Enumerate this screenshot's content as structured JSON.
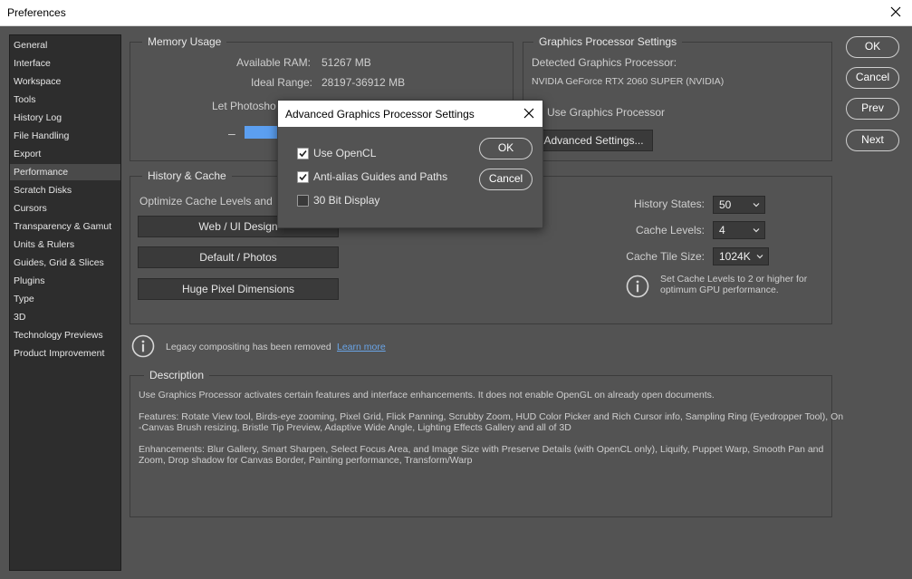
{
  "window": {
    "title": "Preferences"
  },
  "sidebar": {
    "items": [
      {
        "label": "General"
      },
      {
        "label": "Interface"
      },
      {
        "label": "Workspace"
      },
      {
        "label": "Tools"
      },
      {
        "label": "History Log"
      },
      {
        "label": "File Handling"
      },
      {
        "label": "Export"
      },
      {
        "label": "Performance"
      },
      {
        "label": "Scratch Disks"
      },
      {
        "label": "Cursors"
      },
      {
        "label": "Transparency & Gamut"
      },
      {
        "label": "Units & Rulers"
      },
      {
        "label": "Guides, Grid & Slices"
      },
      {
        "label": "Plugins"
      },
      {
        "label": "Type"
      },
      {
        "label": "3D"
      },
      {
        "label": "Technology Previews"
      },
      {
        "label": "Product Improvement"
      }
    ],
    "active": "Performance"
  },
  "memory": {
    "title": "Memory Usage",
    "available_label": "Available RAM:",
    "available_value": "51267 MB",
    "ideal_label": "Ideal Range:",
    "ideal_value": "28197-36912 MB",
    "let_label": "Let Photosho",
    "minus": "–"
  },
  "gpu": {
    "title": "Graphics Processor Settings",
    "detected_label": "Detected Graphics Processor:",
    "detected_value": "NVIDIA GeForce RTX 2060 SUPER (NVIDIA)",
    "use_label": "Use Graphics Processor",
    "advanced_button": "Advanced Settings..."
  },
  "actions": {
    "ok": "OK",
    "cancel": "Cancel",
    "prev": "Prev",
    "next": "Next"
  },
  "history": {
    "title": "History & Cache",
    "optimize_label": "Optimize Cache Levels and",
    "web_button": "Web / UI Design",
    "default_button": "Default / Photos",
    "huge_button": "Huge Pixel Dimensions",
    "states_label": "History States:",
    "states_value": "50",
    "levels_label": "Cache Levels:",
    "levels_value": "4",
    "tile_label": "Cache Tile Size:",
    "tile_value": "1024K",
    "tip_line1": "Set Cache Levels to 2 or higher for",
    "tip_line2": "optimum GPU performance."
  },
  "legacy": {
    "text": "Legacy compositing has been removed",
    "link": "Learn more"
  },
  "description": {
    "title": "Description",
    "p1": "Use Graphics Processor activates certain features and interface enhancements. It does not enable OpenGL on already open documents.",
    "p2_line1": "Features: Rotate View tool, Birds-eye zooming, Pixel Grid, Flick Panning, Scrubby Zoom, HUD Color Picker and Rich Cursor info, Sampling Ring (Eyedropper Tool), On",
    "p2_line2": "-Canvas Brush resizing, Bristle Tip Preview, Adaptive Wide Angle, Lighting Effects Gallery and all of 3D",
    "p3_line1": "Enhancements: Blur Gallery, Smart Sharpen, Select Focus Area, and Image Size with Preserve Details (with OpenCL only), Liquify, Puppet Warp, Smooth Pan and",
    "p3_line2": "Zoom, Drop shadow for Canvas Border, Painting performance, Transform/Warp"
  },
  "dialog": {
    "title": "Advanced Graphics Processor Settings",
    "opencl_label": "Use OpenCL",
    "opencl_checked": true,
    "antialias_label": "Anti-alias Guides and Paths",
    "antialias_checked": true,
    "bit30_label": "30 Bit Display",
    "bit30_checked": false,
    "ok": "OK",
    "cancel": "Cancel"
  },
  "colors": {
    "accent": "#5c9ff0",
    "link": "#6aa5e8"
  }
}
